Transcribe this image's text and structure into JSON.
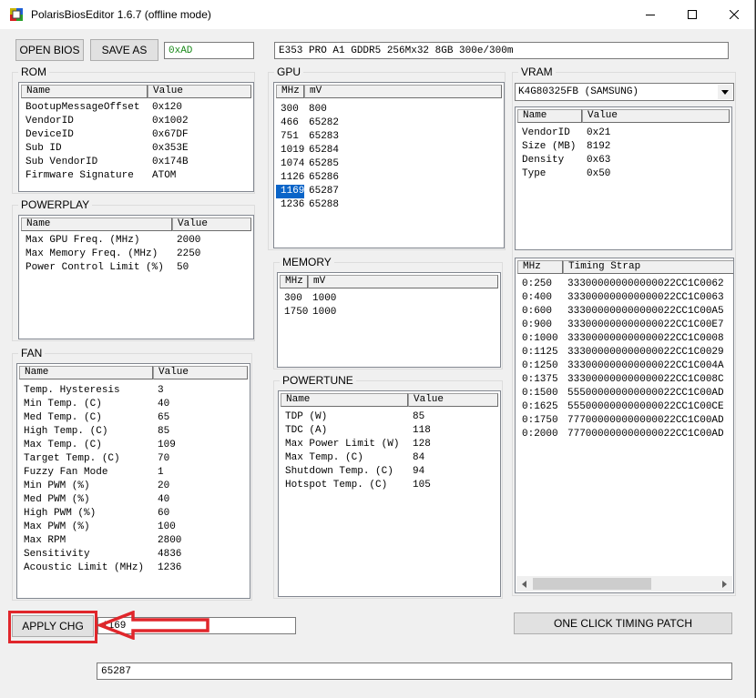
{
  "window": {
    "title": "PolarisBiosEditor 1.6.7 (offline mode)"
  },
  "toolbar": {
    "open_bios_label": "OPEN BIOS",
    "save_as_label": "SAVE AS",
    "checksum_value": "0xAD",
    "bios_info_value": "E353 PRO A1 GDDR5 256Mx32 8GB 300e/300m"
  },
  "rom": {
    "title": "ROM",
    "columns": [
      "Name",
      "Value"
    ],
    "rows": [
      [
        "BootupMessageOffset",
        "0x120"
      ],
      [
        "VendorID",
        "0x1002"
      ],
      [
        "DeviceID",
        "0x67DF"
      ],
      [
        "Sub ID",
        "0x353E"
      ],
      [
        "Sub VendorID",
        "0x174B"
      ],
      [
        "Firmware Signature",
        "ATOM"
      ]
    ]
  },
  "powerplay": {
    "title": "POWERPLAY",
    "columns": [
      "Name",
      "Value"
    ],
    "rows": [
      [
        "Max GPU Freq. (MHz)",
        "2000"
      ],
      [
        "Max Memory Freq. (MHz)",
        "2250"
      ],
      [
        "Power Control Limit (%)",
        "50"
      ]
    ]
  },
  "fan": {
    "title": "FAN",
    "columns": [
      "Name",
      "Value"
    ],
    "rows": [
      [
        "Temp. Hysteresis",
        "3"
      ],
      [
        "Min Temp. (C)",
        "40"
      ],
      [
        "Med Temp. (C)",
        "65"
      ],
      [
        "High Temp. (C)",
        "85"
      ],
      [
        "Max Temp. (C)",
        "109"
      ],
      [
        "Target Temp. (C)",
        "70"
      ],
      [
        "Fuzzy Fan Mode",
        "1"
      ],
      [
        "Min PWM (%)",
        "20"
      ],
      [
        "Med PWM (%)",
        "40"
      ],
      [
        "High PWM (%)",
        "60"
      ],
      [
        "Max PWM (%)",
        "100"
      ],
      [
        "Max RPM",
        "2800"
      ],
      [
        "Sensitivity",
        "4836"
      ],
      [
        "Acoustic Limit (MHz)",
        "1236"
      ]
    ]
  },
  "gpu": {
    "title": "GPU",
    "columns": [
      "MHz",
      "mV"
    ],
    "rows": [
      [
        "300",
        "800"
      ],
      [
        "466",
        "65282"
      ],
      [
        "751",
        "65283"
      ],
      [
        "1019",
        "65284"
      ],
      [
        "1074",
        "65285"
      ],
      [
        "1126",
        "65286"
      ],
      [
        "1169",
        "65287"
      ],
      [
        "1236",
        "65288"
      ]
    ],
    "selected_row": 6
  },
  "memory": {
    "title": "MEMORY",
    "columns": [
      "MHz",
      "mV"
    ],
    "rows": [
      [
        "300",
        "1000"
      ],
      [
        "1750",
        "1000"
      ]
    ]
  },
  "powertune": {
    "title": "POWERTUNE",
    "columns": [
      "Name",
      "Value"
    ],
    "rows": [
      [
        "TDP (W)",
        "85"
      ],
      [
        "TDC (A)",
        "118"
      ],
      [
        "Max Power Limit (W)",
        "128"
      ],
      [
        "Max Temp. (C)",
        "84"
      ],
      [
        "Shutdown Temp. (C)",
        "94"
      ],
      [
        "Hotspot Temp. (C)",
        "105"
      ]
    ]
  },
  "vram": {
    "title": "VRAM",
    "selected_chip": "K4G80325FB (SAMSUNG)",
    "columns": [
      "Name",
      "Value"
    ],
    "rows": [
      [
        "VendorID",
        "0x21"
      ],
      [
        "Size (MB)",
        "8192"
      ],
      [
        "Density",
        "0x63"
      ],
      [
        "Type",
        "0x50"
      ]
    ]
  },
  "timing": {
    "columns": [
      "MHz",
      "Timing Strap"
    ],
    "rows": [
      [
        "0:250",
        "333000000000000022CC1C0062"
      ],
      [
        "0:400",
        "333000000000000022CC1C0063"
      ],
      [
        "0:600",
        "333000000000000022CC1C00A5"
      ],
      [
        "0:900",
        "333000000000000022CC1C00E7"
      ],
      [
        "0:1000",
        "333000000000000022CC1C0008"
      ],
      [
        "0:1125",
        "333000000000000022CC1C0029"
      ],
      [
        "0:1250",
        "333000000000000022CC1C004A"
      ],
      [
        "0:1375",
        "333000000000000022CC1C008C"
      ],
      [
        "0:1500",
        "555000000000000022CC1C00AD"
      ],
      [
        "0:1625",
        "555000000000000022CC1C00CE"
      ],
      [
        "0:1750",
        "777000000000000022CC1C00AD"
      ],
      [
        "0:2000",
        "777000000000000022CC1C00AD"
      ]
    ]
  },
  "bottom": {
    "apply_label": "APPLY CHG",
    "edit_value": "1169",
    "timing_patch_label": "ONE CLICK TIMING PATCH",
    "status_value": "65287"
  },
  "colors": {
    "annotation": "#e0262b",
    "selection": "#0a64c8",
    "checksum_text": "#1a8a1a"
  },
  "icons": {
    "app": "app-icon",
    "minimize": "minimize-icon",
    "maximize": "maximize-icon",
    "close": "close-icon",
    "dropdown": "chevron-down-icon",
    "annotation": "arrow-left-icon"
  }
}
